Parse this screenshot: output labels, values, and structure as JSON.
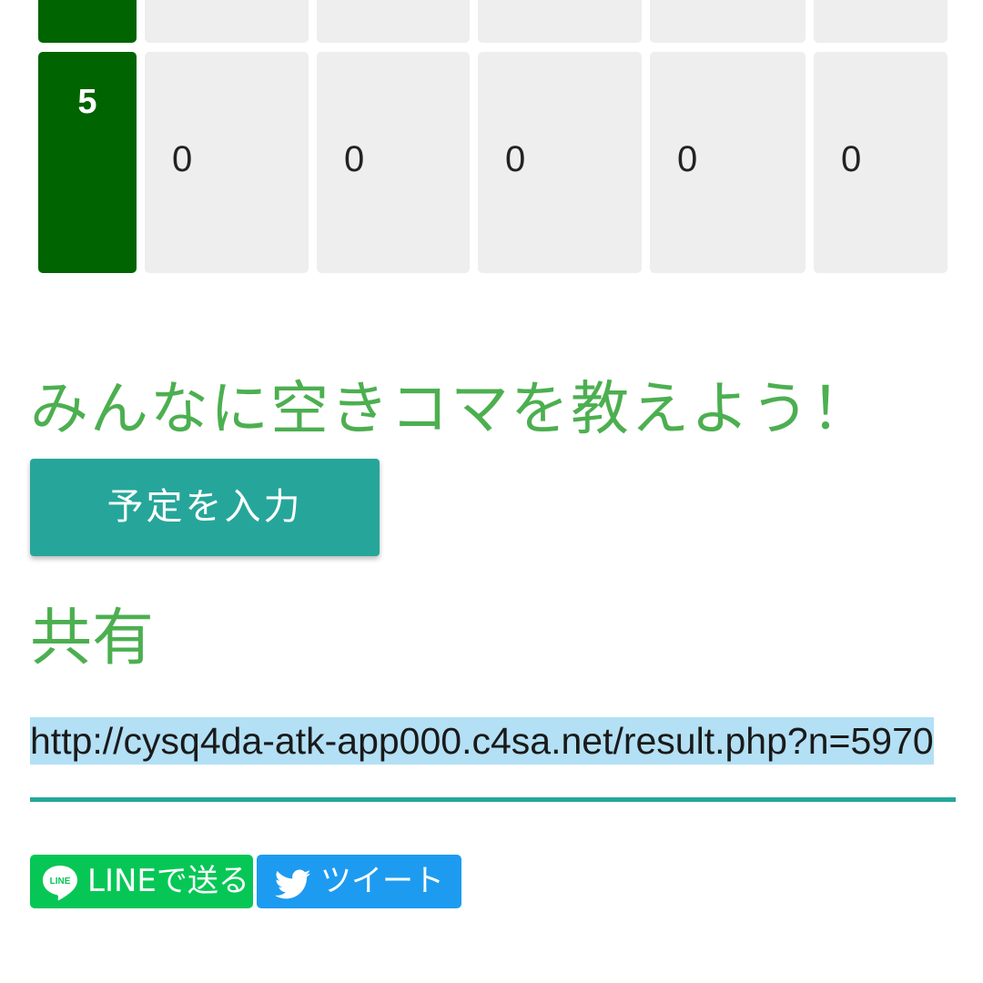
{
  "table": {
    "rows": [
      {
        "period": "",
        "slots": [
          "",
          "",
          "",
          "",
          ""
        ]
      },
      {
        "period": "5",
        "slots": [
          "0",
          "0",
          "0",
          "0",
          "0"
        ]
      }
    ]
  },
  "invite": {
    "heading": "みんなに空きコマを教えよう！",
    "button_label": "予定を入力"
  },
  "share": {
    "heading": "共有",
    "url": "http://cysq4da-atk-app000.c4sa.net/result.php?n=5970",
    "line_label": "LINEで送る",
    "line_icon_text": "LINE",
    "tweet_label": "ツイート"
  },
  "colors": {
    "period_bg": "#006400",
    "slot_bg": "#eeeeee",
    "heading": "#4caf50",
    "button": "#26a69a",
    "line": "#06c755",
    "twitter": "#1d9bf0"
  }
}
